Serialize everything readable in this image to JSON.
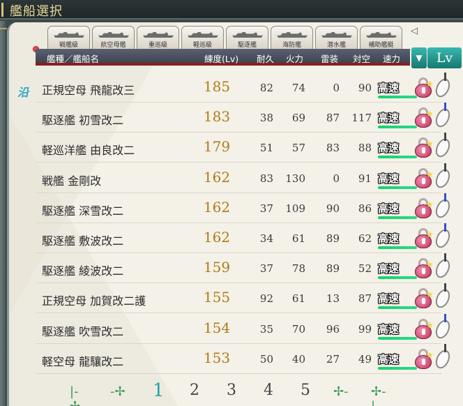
{
  "window": {
    "title": "艦船選択"
  },
  "tabs": [
    {
      "label": "戦艦級"
    },
    {
      "label": "航空母艦"
    },
    {
      "label": "重巡級"
    },
    {
      "label": "軽巡級"
    },
    {
      "label": "駆逐艦"
    },
    {
      "label": "海防艦"
    },
    {
      "label": "潜水艦"
    },
    {
      "label": "補助艦艇"
    }
  ],
  "tab_arrow": "◁",
  "header": {
    "name": "艦種／艦船名",
    "lv": "練度(Lv)",
    "hp": "耐久",
    "firepower": "火力",
    "torpedo": "雷装",
    "aa": "対空",
    "speed": "速力"
  },
  "sort": {
    "toggle": "▼",
    "key": "Lv"
  },
  "fleet_badge": "沿",
  "ships": [
    {
      "type": "正規空母",
      "name": "飛龍改三",
      "lv": "185",
      "hp": "82",
      "fp": "74",
      "tp": "0",
      "aa": "90",
      "speed": "高速"
    },
    {
      "type": "駆逐艦",
      "name": "初雪改二",
      "lv": "183",
      "hp": "38",
      "fp": "69",
      "tp": "87",
      "aa": "117",
      "speed": "高速"
    },
    {
      "type": "軽巡洋艦",
      "name": "由良改二",
      "lv": "179",
      "hp": "51",
      "fp": "57",
      "tp": "83",
      "aa": "88",
      "speed": "高速"
    },
    {
      "type": "戦艦",
      "name": "金剛改",
      "lv": "162",
      "hp": "83",
      "fp": "130",
      "tp": "0",
      "aa": "91",
      "speed": "高速"
    },
    {
      "type": "駆逐艦",
      "name": "深雪改二",
      "lv": "162",
      "hp": "37",
      "fp": "109",
      "tp": "90",
      "aa": "86",
      "speed": "高速"
    },
    {
      "type": "駆逐艦",
      "name": "敷波改二",
      "lv": "162",
      "hp": "34",
      "fp": "61",
      "tp": "89",
      "aa": "62",
      "speed": "高速"
    },
    {
      "type": "駆逐艦",
      "name": "綾波改二",
      "lv": "159",
      "hp": "37",
      "fp": "78",
      "tp": "89",
      "aa": "52",
      "speed": "高速"
    },
    {
      "type": "正規空母",
      "name": "加賀改二護",
      "lv": "155",
      "hp": "92",
      "fp": "61",
      "tp": "13",
      "aa": "87",
      "speed": "高速"
    },
    {
      "type": "駆逐艦",
      "name": "吹雪改二",
      "lv": "154",
      "hp": "35",
      "fp": "70",
      "tp": "96",
      "aa": "99",
      "speed": "高速"
    },
    {
      "type": "軽空母",
      "name": "龍驤改二",
      "lv": "153",
      "hp": "50",
      "fp": "40",
      "tp": "27",
      "aa": "49",
      "speed": "高速"
    }
  ],
  "pager": {
    "first": "|-✢",
    "prev": "-✢",
    "pages": [
      "1",
      "2",
      "3",
      "4",
      "5"
    ],
    "current": "1",
    "next": "✢-",
    "last": "✢-|"
  },
  "colors": {
    "level": "#b07a1a",
    "active_page": "#1fa3a8",
    "sort_button": "#1f9890",
    "header_underline": "#8a1d1d"
  }
}
